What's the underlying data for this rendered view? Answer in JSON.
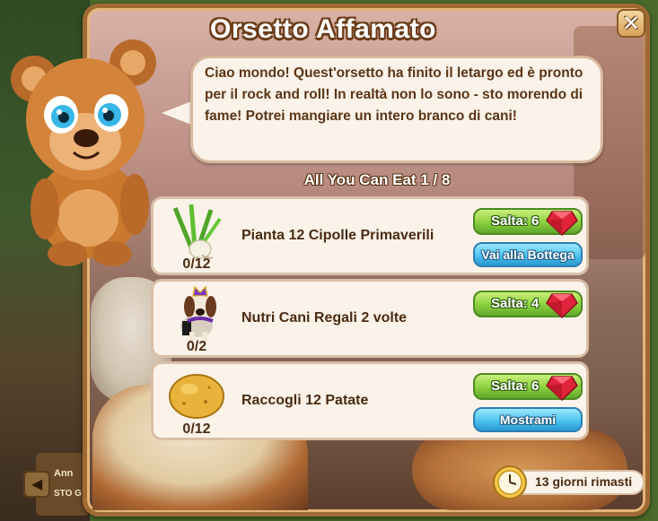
{
  "dialog": {
    "title": "Orsetto Affamato",
    "close_label": "✕",
    "speech": "Ciao mondo! Quest'orsetto ha finito il letargo ed è pronto per il rock and roll! In realtà non lo sono - sto morendo di fame! Potrei mangiare un intero branco di cani!",
    "subtitle": "All You Can Eat 1 / 8"
  },
  "tasks": [
    {
      "icon": "spring-onion-icon",
      "progress": "0/12",
      "label": "Pianta 12 Cipolle Primaverili",
      "skip_label": "Salta: 6",
      "action_label": "Vai alla Bottega"
    },
    {
      "icon": "royal-dog-icon",
      "progress": "0/2",
      "label": "Nutri Cani Regali 2 volte",
      "skip_label": "Salta: 4",
      "action_label": ""
    },
    {
      "icon": "potato-icon",
      "progress": "0/12",
      "label": "Raccogli 12 Patate",
      "skip_label": "Salta: 6",
      "action_label": "Mostrami"
    }
  ],
  "timer": {
    "text": "13 giorni rimasti",
    "icon": "clock-icon"
  },
  "background": {
    "sign_line1": "Ann",
    "sign_line2": "STO G"
  },
  "colors": {
    "skip_button": "#8bcf3e",
    "action_button": "#4cc2ef",
    "gem": "#e0243a",
    "frame": "#a06a34"
  }
}
